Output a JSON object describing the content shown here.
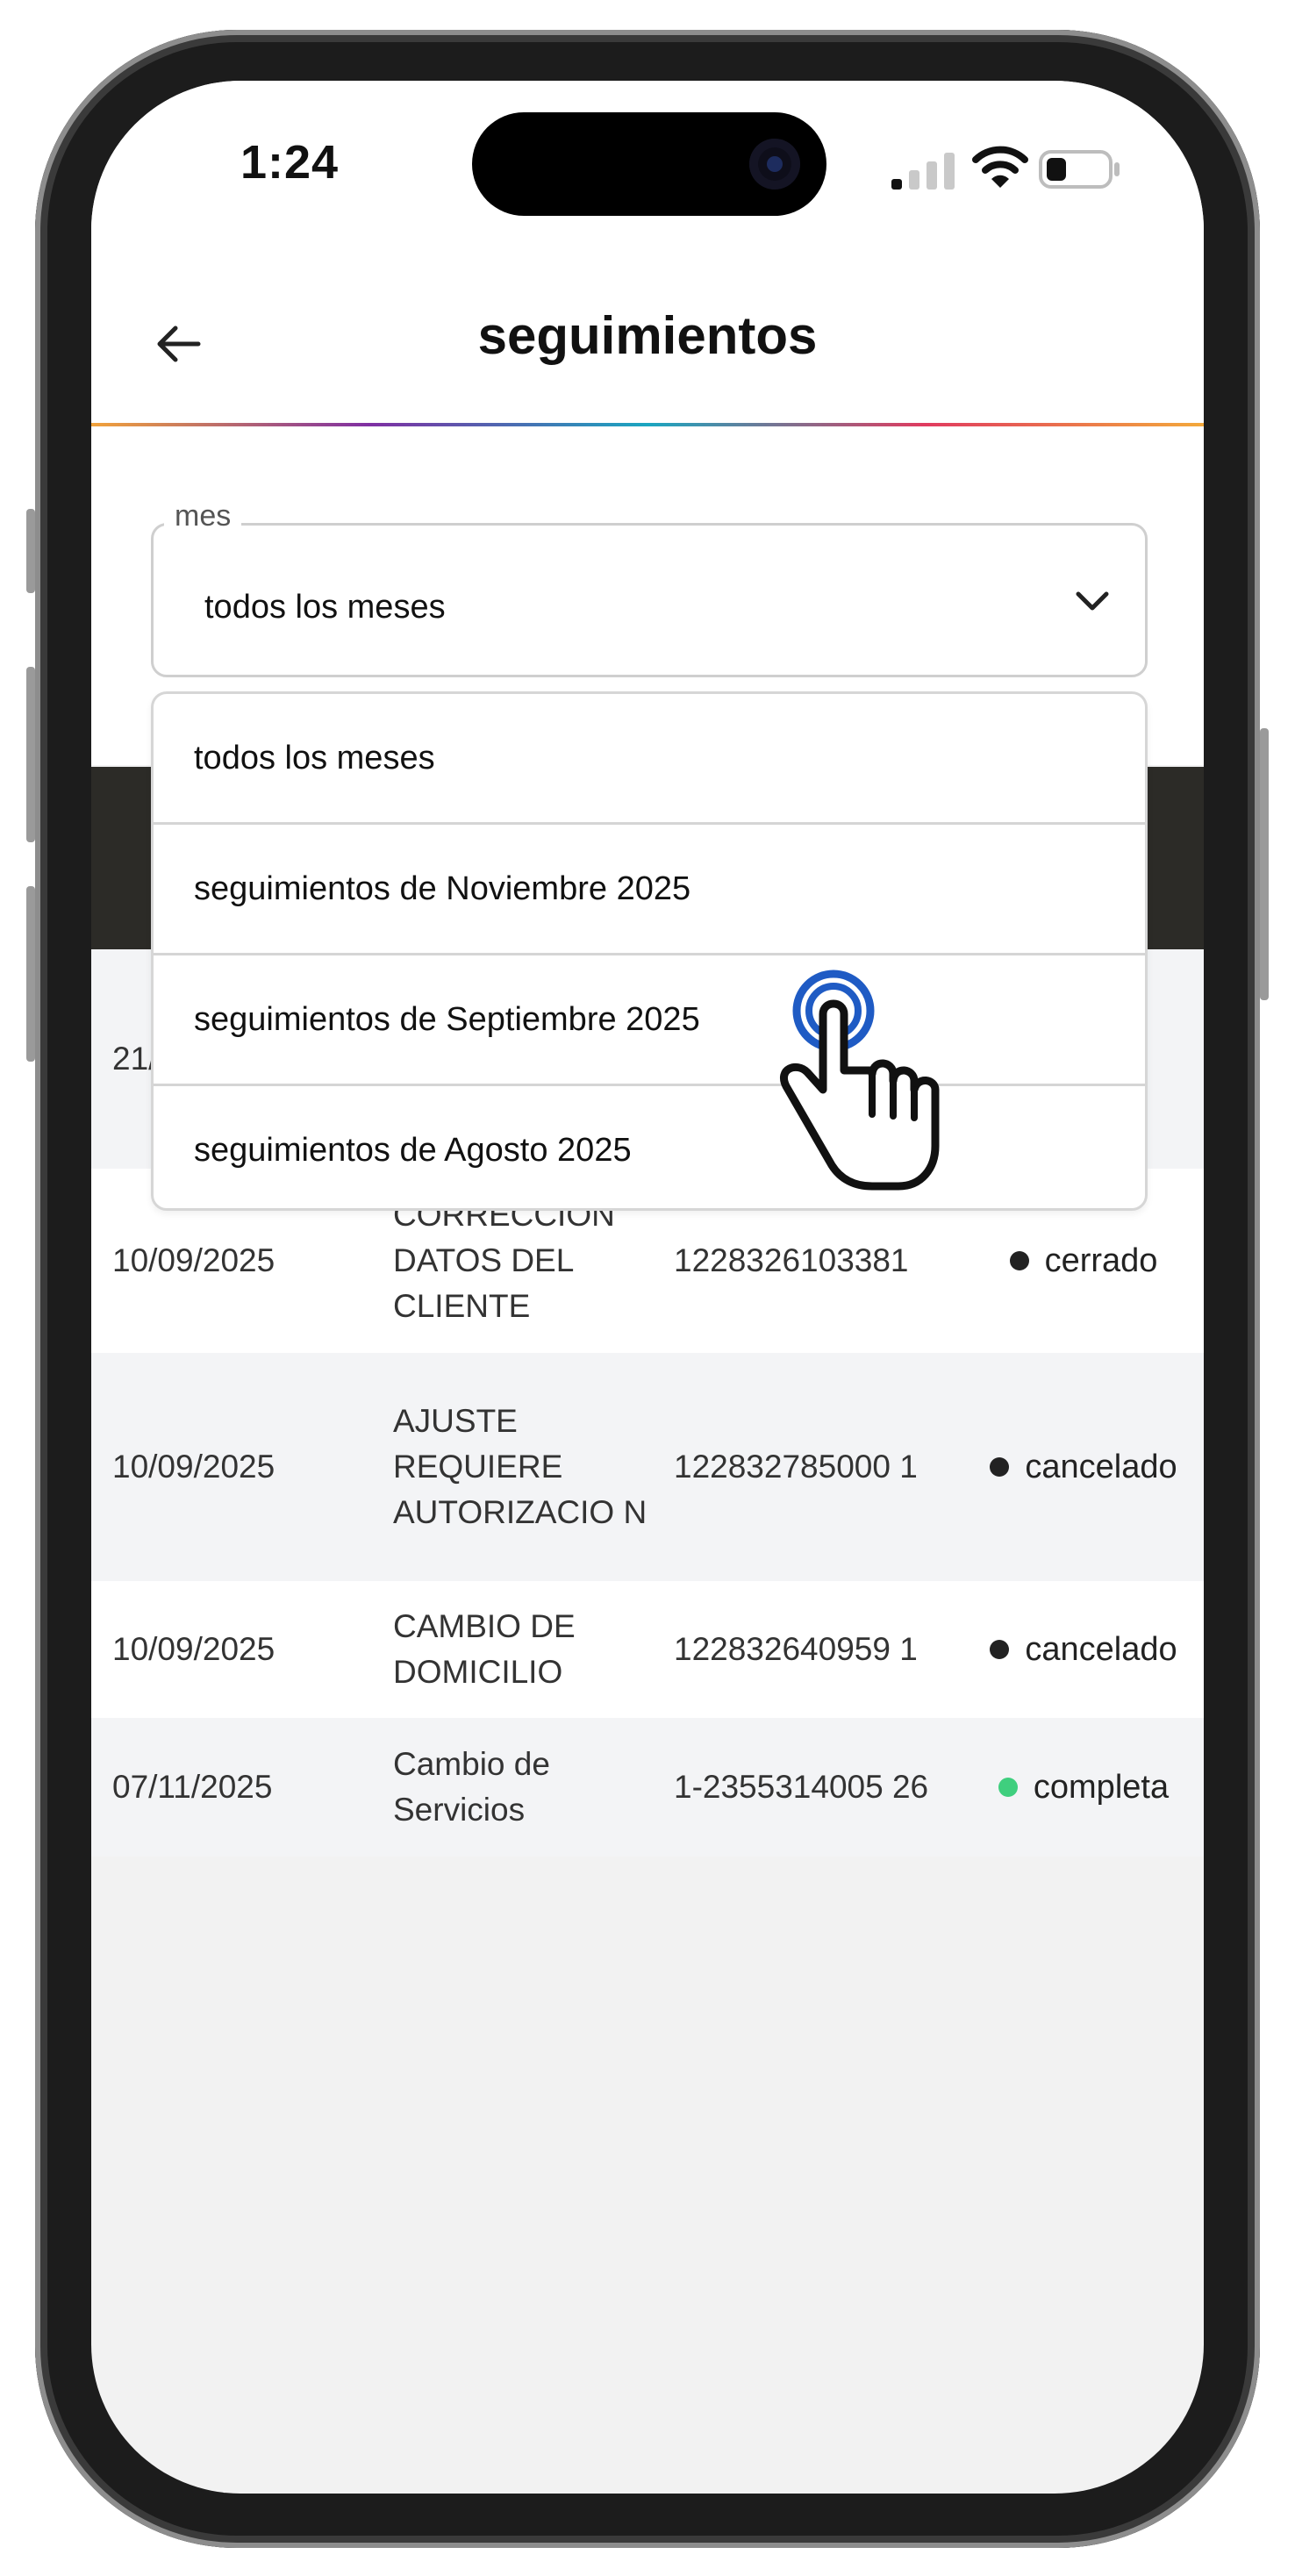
{
  "status_bar": {
    "time": "1:24"
  },
  "header": {
    "title": "seguimientos"
  },
  "month_select": {
    "legend": "mes",
    "value": "todos los meses"
  },
  "dropdown": {
    "options": [
      "todos los meses",
      "seguimientos de Noviembre 2025",
      "seguimientos de Septiembre 2025",
      "seguimientos de Agosto 2025"
    ]
  },
  "rows": [
    {
      "date": "21/",
      "type": "",
      "id": "",
      "status": ""
    },
    {
      "date": "10/09/2025",
      "type": "CORRECCIÓN DATOS DEL CLIENTE",
      "id": "1228326103381",
      "status": "cerrado",
      "status_color": "#222222"
    },
    {
      "date": "10/09/2025",
      "type": "AJUSTE REQUIERE AUTORIZACIO N",
      "id": "122832785000 1",
      "status": "cancelado",
      "status_color": "#222222"
    },
    {
      "date": "10/09/2025",
      "type": "CAMBIO DE DOMICILIO",
      "id": "122832640959 1",
      "status": "cancelado",
      "status_color": "#222222"
    },
    {
      "date": "07/11/2025",
      "type": "Cambio de Servicios",
      "id": "1-2355314005 26",
      "status": "completa",
      "status_color": "#3fcf7e"
    }
  ]
}
